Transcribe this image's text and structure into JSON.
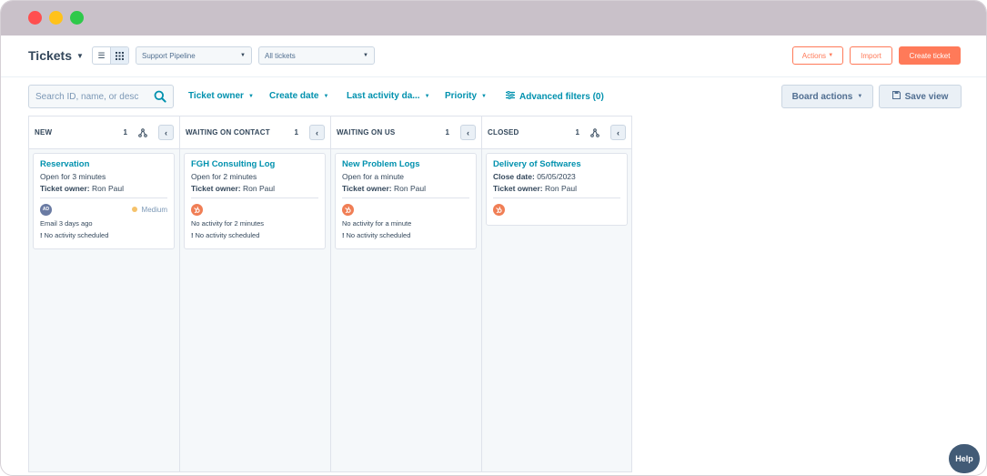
{
  "header": {
    "title": "Tickets",
    "pipeline_select": "Support Pipeline",
    "view_select": "All tickets",
    "actions_label": "Actions",
    "import_label": "Import",
    "create_label": "Create ticket"
  },
  "filters": {
    "search_placeholder": "Search ID, name, or desc",
    "items": [
      "Ticket owner",
      "Create date",
      "Last activity da...",
      "Priority",
      "Advanced filters (0)"
    ],
    "board_actions": "Board actions",
    "save_view": "Save view"
  },
  "columns": [
    {
      "name": "NEW",
      "count": "1",
      "card": {
        "title": "Reservation",
        "line1": "Open for 3 minutes",
        "owner_label": "Ticket owner:",
        "owner": "Ron Paul",
        "avatar": "AD",
        "priority": "Medium",
        "activity": "Email 3 days ago",
        "scheduled": "No activity scheduled"
      }
    },
    {
      "name": "WAITING ON CONTACT",
      "count": "1",
      "card": {
        "title": "FGH Consulting Log",
        "line1": "Open for 2 minutes",
        "owner_label": "Ticket owner:",
        "owner": "Ron Paul",
        "activity": "No activity for 2 minutes",
        "scheduled": "No activity scheduled"
      }
    },
    {
      "name": "WAITING ON US",
      "count": "1",
      "card": {
        "title": "New Problem Logs",
        "line1": "Open for a minute",
        "owner_label": "Ticket owner:",
        "owner": "Ron Paul",
        "activity": "No activity for a minute",
        "scheduled": "No activity scheduled"
      }
    },
    {
      "name": "CLOSED",
      "count": "1",
      "card": {
        "title": "Delivery of Softwares",
        "close_label": "Close date:",
        "close_date": "05/05/2023",
        "owner_label": "Ticket owner:",
        "owner": "Ron Paul"
      }
    }
  ],
  "help_label": "Help",
  "colors": {
    "accent": "#0091ae",
    "primary_button": "#ff7a59",
    "titlebar": "#c9c1c9",
    "hubspot_orange": "#f07e55"
  }
}
